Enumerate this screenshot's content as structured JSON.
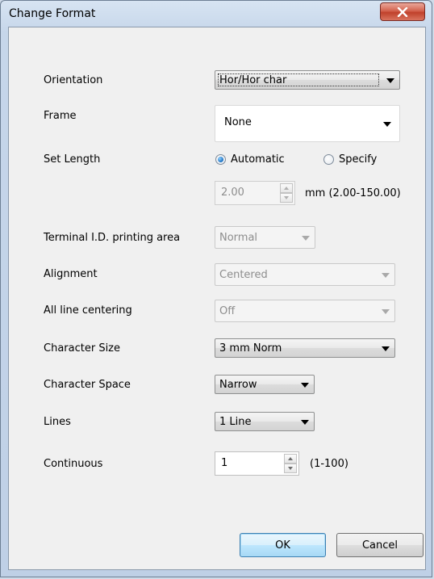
{
  "window": {
    "title": "Change Format"
  },
  "labels": {
    "orientation": "Orientation",
    "frame": "Frame",
    "set_length": "Set Length",
    "terminal_id": "Terminal I.D. printing area",
    "alignment": "Alignment",
    "all_line_centering": "All line centering",
    "character_size": "Character Size",
    "character_space": "Character Space",
    "lines": "Lines",
    "continuous": "Continuous"
  },
  "fields": {
    "orientation": "Hor/Hor char",
    "frame": "None",
    "set_length_automatic": "Automatic",
    "set_length_specify": "Specify",
    "length_value": "2.00",
    "length_range": "mm  (2.00-150.00)",
    "terminal_id": "Normal",
    "alignment": "Centered",
    "all_line_centering": "Off",
    "character_size": "3 mm Norm",
    "character_space": "Narrow",
    "lines": "1 Line",
    "continuous_value": "1",
    "continuous_range": "(1-100)"
  },
  "state": {
    "set_length_selected": "Automatic"
  },
  "buttons": {
    "ok": "OK",
    "cancel": "Cancel"
  },
  "icons": {
    "close": "close-icon",
    "dropdown": "chevron-down-icon",
    "spin_up": "spin-up-icon",
    "spin_down": "spin-down-icon"
  },
  "colors": {
    "close_button": "#c0412b",
    "default_button_border": "#3c7fb1",
    "client_background": "#f0f0f0"
  }
}
